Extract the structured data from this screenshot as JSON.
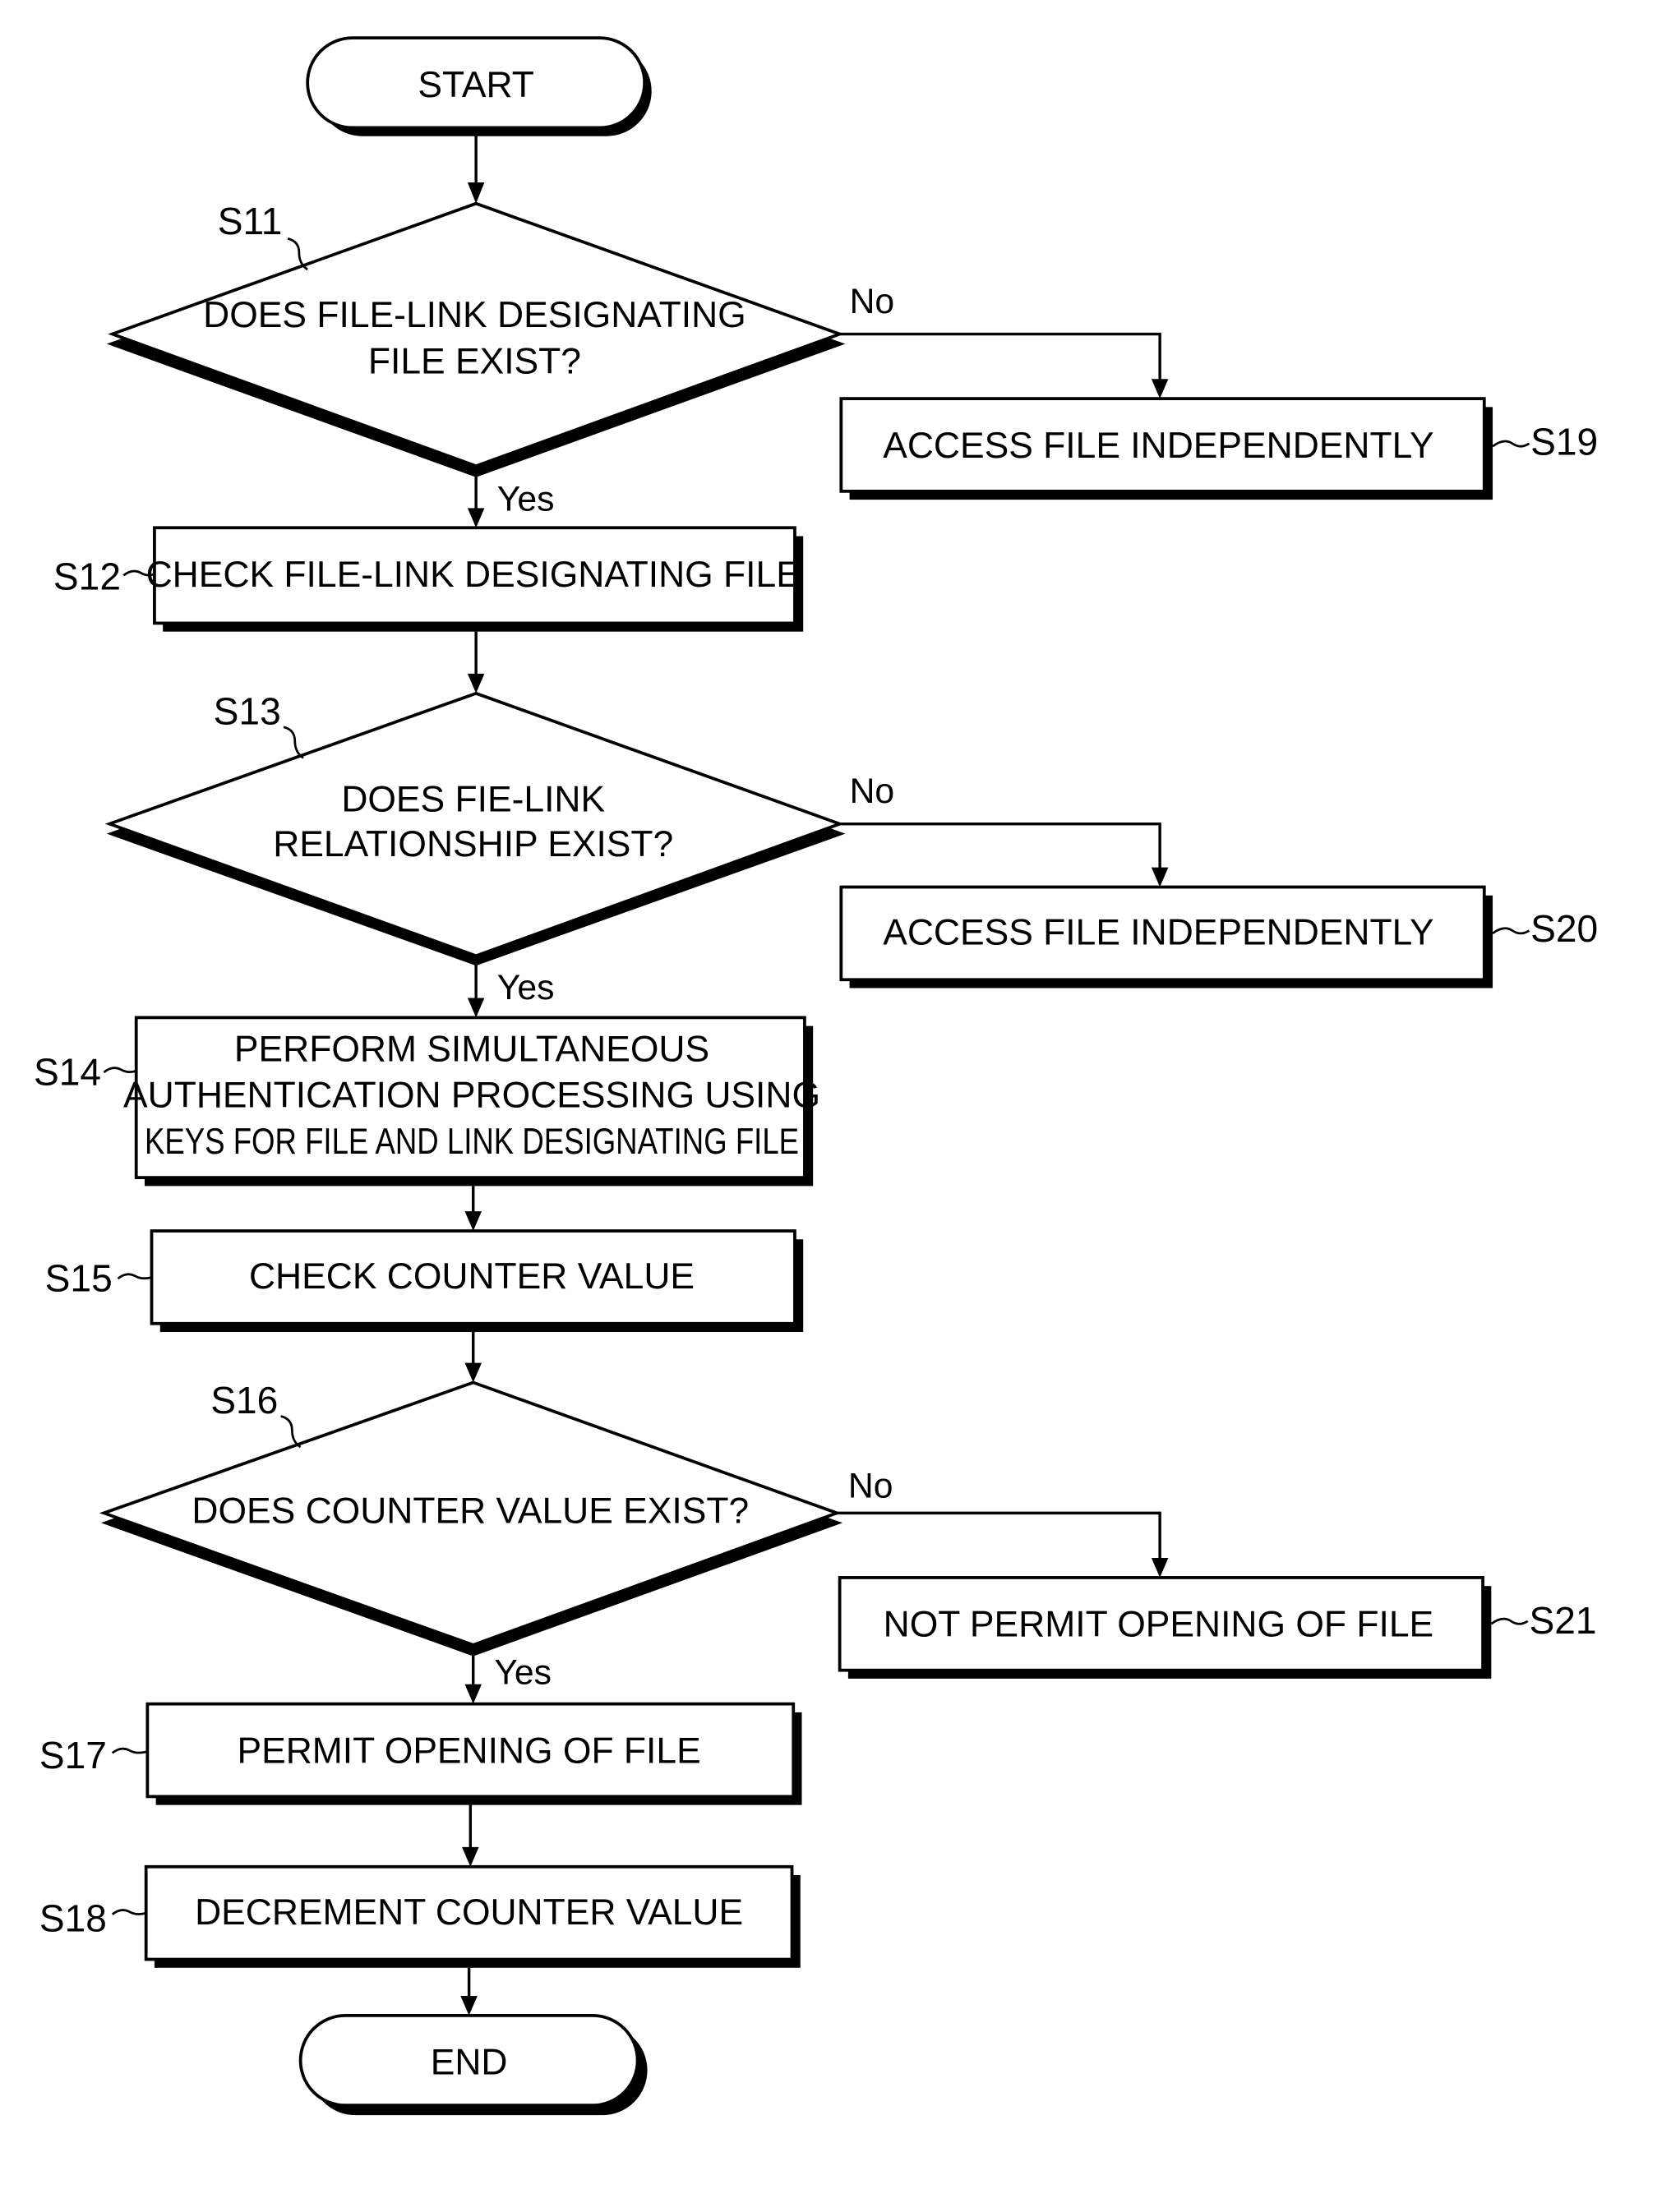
{
  "flowchart": {
    "terminals": {
      "start": "START",
      "end": "END"
    },
    "steps": {
      "S11": {
        "id": "S11",
        "type": "decision",
        "lines": [
          "DOES FILE-LINK DESIGNATING",
          "FILE EXIST?"
        ]
      },
      "S12": {
        "id": "S12",
        "type": "process",
        "lines": [
          "CHECK FILE-LINK DESIGNATING FILE"
        ]
      },
      "S13": {
        "id": "S13",
        "type": "decision",
        "lines": [
          "DOES FIE-LINK",
          "RELATIONSHIP EXIST?"
        ]
      },
      "S14": {
        "id": "S14",
        "type": "process",
        "lines": [
          "PERFORM SIMULTANEOUS",
          "AUTHENTICATION PROCESSING USING",
          "KEYS FOR FILE AND LINK DESIGNATING FILE"
        ]
      },
      "S15": {
        "id": "S15",
        "type": "process",
        "lines": [
          "CHECK COUNTER VALUE"
        ]
      },
      "S16": {
        "id": "S16",
        "type": "decision",
        "lines": [
          "DOES COUNTER VALUE EXIST?"
        ]
      },
      "S17": {
        "id": "S17",
        "type": "process",
        "lines": [
          "PERMIT OPENING OF FILE"
        ]
      },
      "S18": {
        "id": "S18",
        "type": "process",
        "lines": [
          "DECREMENT COUNTER VALUE"
        ]
      },
      "S19": {
        "id": "S19",
        "type": "process",
        "lines": [
          "ACCESS FILE INDEPENDENTLY"
        ]
      },
      "S20": {
        "id": "S20",
        "type": "process",
        "lines": [
          "ACCESS FILE INDEPENDENTLY"
        ]
      },
      "S21": {
        "id": "S21",
        "type": "process",
        "lines": [
          "NOT PERMIT OPENING OF FILE"
        ]
      }
    },
    "branches": {
      "yes": "Yes",
      "no": "No"
    },
    "edges": [
      {
        "from": "START",
        "to": "S11"
      },
      {
        "from": "S11",
        "to": "S12",
        "label": "Yes"
      },
      {
        "from": "S11",
        "to": "S19",
        "label": "No"
      },
      {
        "from": "S12",
        "to": "S13"
      },
      {
        "from": "S13",
        "to": "S14",
        "label": "Yes"
      },
      {
        "from": "S13",
        "to": "S20",
        "label": "No"
      },
      {
        "from": "S14",
        "to": "S15"
      },
      {
        "from": "S15",
        "to": "S16"
      },
      {
        "from": "S16",
        "to": "S17",
        "label": "Yes"
      },
      {
        "from": "S16",
        "to": "S21",
        "label": "No"
      },
      {
        "from": "S17",
        "to": "S18"
      },
      {
        "from": "S18",
        "to": "END"
      }
    ]
  }
}
